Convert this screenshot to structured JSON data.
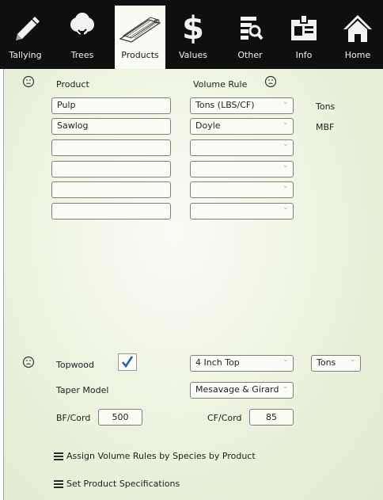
{
  "toolbar": {
    "tabs": [
      {
        "label": "Tallying",
        "icon": "pencil-icon"
      },
      {
        "label": "Trees",
        "icon": "tree-icon"
      },
      {
        "label": "Products",
        "icon": "lumber-icon"
      },
      {
        "label": "Values",
        "icon": "dollar-icon"
      },
      {
        "label": "Other",
        "icon": "list-search-icon"
      },
      {
        "label": "Info",
        "icon": "id-card-icon"
      },
      {
        "label": "Home",
        "icon": "home-icon"
      }
    ],
    "active_tab": "Products"
  },
  "products_table": {
    "header_product": "Product",
    "header_volume_rule": "Volume Rule",
    "rows": [
      {
        "product": "Pulp",
        "volume_rule": "Tons (LBS/CF)",
        "unit": "Tons"
      },
      {
        "product": "Sawlog",
        "volume_rule": "Doyle",
        "unit": "MBF"
      },
      {
        "product": "",
        "volume_rule": "",
        "unit": ""
      },
      {
        "product": "",
        "volume_rule": "",
        "unit": ""
      },
      {
        "product": "",
        "volume_rule": "",
        "unit": ""
      },
      {
        "product": "",
        "volume_rule": "",
        "unit": ""
      }
    ]
  },
  "topwood": {
    "label": "Topwood",
    "checked": true,
    "top_value": "4 Inch Top",
    "unit_value": "Tons"
  },
  "taper_model": {
    "label": "Taper Model",
    "value": "Mesavage & Girard"
  },
  "conversion": {
    "bf_label": "BF/Cord",
    "bf_value": "500",
    "cf_label": "CF/Cord",
    "cf_value": "85"
  },
  "links": {
    "assign_volume_rules": "Assign Volume Rules by Species by Product",
    "set_product_specs": "Set Product Specifications"
  },
  "colors": {
    "toolbar_bg": "#0f0f10",
    "panel_bg": "#e6efd6",
    "check_color": "#2b5fa8"
  }
}
